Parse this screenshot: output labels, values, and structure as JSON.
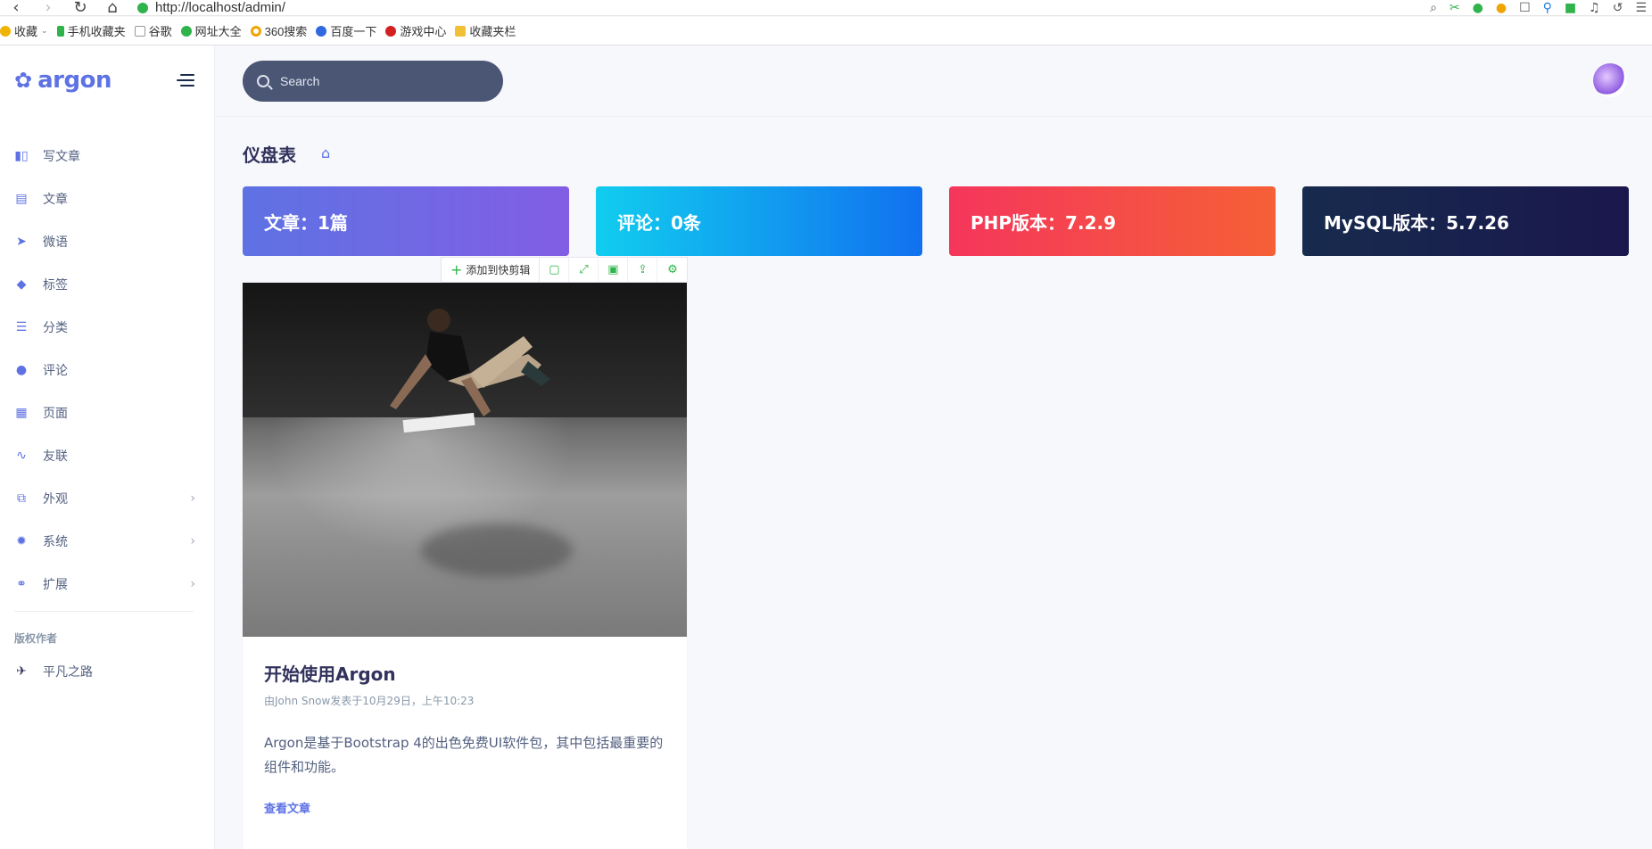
{
  "browser": {
    "url": "http://localhost/admin/",
    "bookmarks": [
      {
        "label": "收藏",
        "icon": "star-icon",
        "color": "#f0b400"
      },
      {
        "label": "手机收藏夹",
        "icon": "phone-icon",
        "color": "#2fb34a"
      },
      {
        "label": "谷歌",
        "icon": "page-icon",
        "color": "#999999"
      },
      {
        "label": "网址大全",
        "icon": "globe-icon",
        "color": "#2fb34a"
      },
      {
        "label": "360搜索",
        "icon": "search-ring-icon",
        "color": "#f0a400"
      },
      {
        "label": "百度一下",
        "icon": "paw-icon",
        "color": "#3068e0"
      },
      {
        "label": "游戏中心",
        "icon": "game-icon",
        "color": "#d32020"
      },
      {
        "label": "收藏夹栏",
        "icon": "folder-icon",
        "color": "#f2c037"
      }
    ]
  },
  "sidebar": {
    "logo_text": "argon",
    "items": [
      {
        "label": "写文章",
        "icon": "books-icon",
        "chevron": false
      },
      {
        "label": "文章",
        "icon": "document-icon",
        "chevron": false
      },
      {
        "label": "微语",
        "icon": "paper-plane-icon",
        "chevron": false
      },
      {
        "label": "标签",
        "icon": "tag-icon",
        "chevron": false
      },
      {
        "label": "分类",
        "icon": "list-icon",
        "chevron": false
      },
      {
        "label": "评论",
        "icon": "chat-bubble-icon",
        "chevron": false
      },
      {
        "label": "页面",
        "icon": "calendar-icon",
        "chevron": false
      },
      {
        "label": "友联",
        "icon": "pulse-icon",
        "chevron": false
      },
      {
        "label": "外观",
        "icon": "windows-icon",
        "chevron": true
      },
      {
        "label": "系统",
        "icon": "gear-icon",
        "chevron": true
      },
      {
        "label": "扩展",
        "icon": "extension-icon",
        "chevron": true
      }
    ],
    "section_title": "版权作者",
    "author": {
      "label": "平凡之路",
      "icon": "rocket-icon"
    }
  },
  "topbar": {
    "search_placeholder": "Search"
  },
  "page": {
    "title": "仪盘表"
  },
  "stats": [
    {
      "label": "文章：1篇"
    },
    {
      "label": "评论：0条"
    },
    {
      "label": "PHP版本：7.2.9"
    },
    {
      "label": "MySQL版本：5.7.26"
    }
  ],
  "clip_toolbar": {
    "add_label": "添加到快剪辑"
  },
  "post": {
    "title": "开始使用Argon",
    "meta": "由John Snow发表于10月29日，上午10:23",
    "excerpt": "Argon是基于Bootstrap 4的出色免费UI软件包，其中包括最重要的组件和功能。",
    "link": "查看文章"
  }
}
